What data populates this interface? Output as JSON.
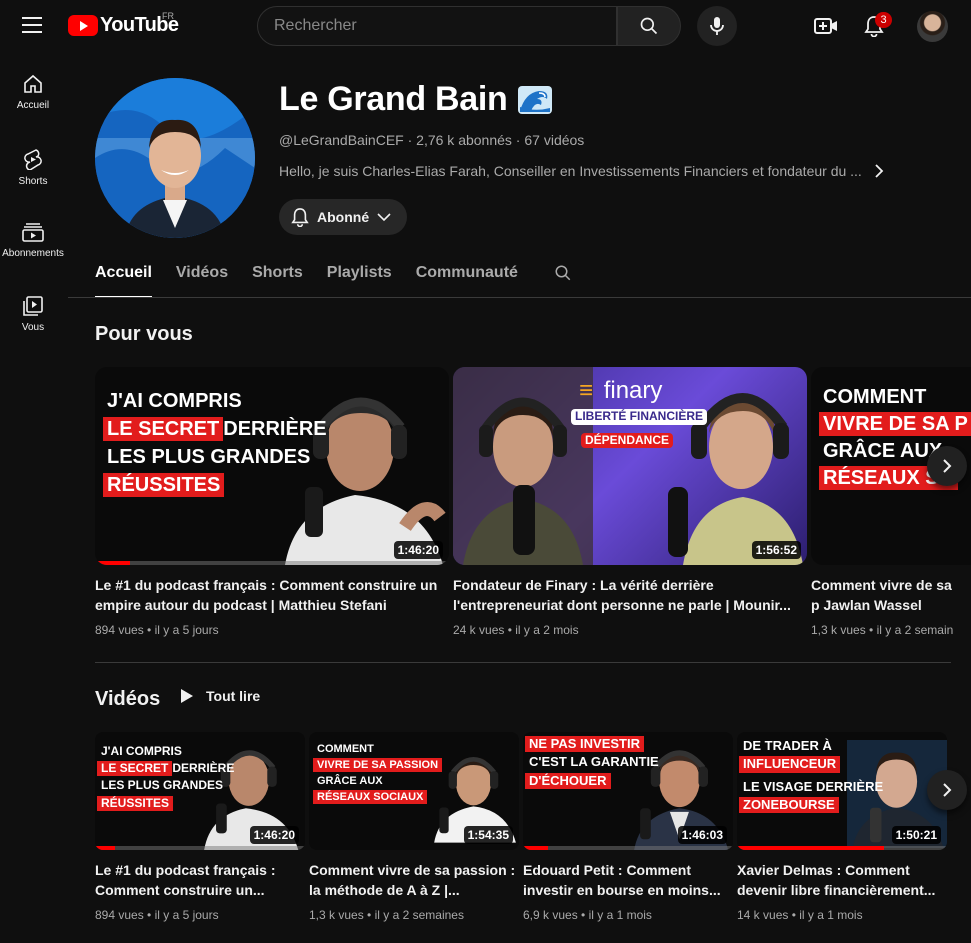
{
  "app": {
    "logo_text": "YouTube",
    "country": "FR"
  },
  "search": {
    "placeholder": "Rechercher"
  },
  "notifications": {
    "count": "3"
  },
  "sidebar": {
    "items": [
      {
        "label": "Accueil",
        "icon": "home-icon"
      },
      {
        "label": "Shorts",
        "icon": "shorts-icon"
      },
      {
        "label": "Abonnements",
        "icon": "subscriptions-icon"
      },
      {
        "label": "Vous",
        "icon": "you-icon"
      }
    ]
  },
  "channel": {
    "name": "Le Grand Bain",
    "handle": "@LeGrandBainCEF",
    "subscribers": "2,76 k abonnés",
    "videos_count": "67 vidéos",
    "separator": " · ",
    "description": "Hello, je suis Charles-Elias Farah, Conseiller en Investissements Financiers et fondateur du ...",
    "subscribe_label": "Abonné"
  },
  "tabs": [
    "Accueil",
    "Vidéos",
    "Shorts",
    "Playlists",
    "Communauté"
  ],
  "for_you": {
    "title": "Pour vous",
    "videos": [
      {
        "title": "Le #1 du podcast français : Comment construire un empire autour du podcast | Matthieu Stefani",
        "views": "894 vues",
        "age": "il y a 5 jours",
        "duration": "1:46:20",
        "progress": 0.1,
        "thumb_lines": [
          "J'AI COMPRIS",
          "LE SECRET",
          "DERRIÈRE",
          "LES PLUS GRANDES",
          "RÉUSSITES"
        ]
      },
      {
        "title": "Fondateur de Finary : La vérité derrière l'entrepreneuriat dont personne ne parle | Mounir...",
        "views": "24 k vues",
        "age": "il y a 2 mois",
        "duration": "1:56:52",
        "progress": 0,
        "thumb_lines": [
          "finary",
          "LIBERTÉ FINANCIÈRE",
          "DÉPENDANCE"
        ]
      },
      {
        "title": "Comment vivre de sa p Jawlan Wassel",
        "views": "1,3 k vues",
        "age": "il y a 2 semain",
        "duration": "",
        "progress": 0,
        "thumb_lines": [
          "COMMENT",
          "VIVRE DE SA P",
          "GRÂCE AUX",
          "RÉSEAUX SO"
        ]
      }
    ]
  },
  "videos_section": {
    "title": "Vidéos",
    "play_all": "Tout lire",
    "videos": [
      {
        "title": "Le #1 du podcast français : Comment construire un...",
        "views": "894 vues",
        "age": "il y a 5 jours",
        "duration": "1:46:20",
        "progress": 0.1,
        "thumb_lines": [
          "J'AI COMPRIS",
          "LE SECRET",
          "DERRIÈRE",
          "LES PLUS GRANDES",
          "RÉUSSITES"
        ]
      },
      {
        "title": "Comment vivre de sa passion : la méthode de A à Z |...",
        "views": "1,3 k vues",
        "age": "il y a 2 semaines",
        "duration": "1:54:35",
        "progress": 0,
        "thumb_lines": [
          "COMMENT",
          "VIVRE DE SA PASSION",
          "GRÂCE AUX",
          "RÉSEAUX SOCIAUX"
        ]
      },
      {
        "title": "Edouard Petit : Comment investir en bourse en moins...",
        "views": "6,9 k vues",
        "age": "il y a 1 mois",
        "duration": "1:46:03",
        "progress": 0.12,
        "thumb_lines": [
          "NE PAS INVESTIR",
          "C'EST LA GARANTIE",
          "D'ÉCHOUER"
        ]
      },
      {
        "title": "Xavier Delmas : Comment devenir libre financièrement...",
        "views": "14 k vues",
        "age": "il y a 1 mois",
        "duration": "1:50:21",
        "progress": 0.7,
        "thumb_lines": [
          "DE TRADER À",
          "INFLUENCEUR",
          "LE VISAGE DERRIÈRE",
          "ZONEBOURSE"
        ]
      }
    ]
  },
  "colors": {
    "accent": "#ff0000",
    "background": "#0f0f0f",
    "thumb_red": "#e21c1c"
  }
}
